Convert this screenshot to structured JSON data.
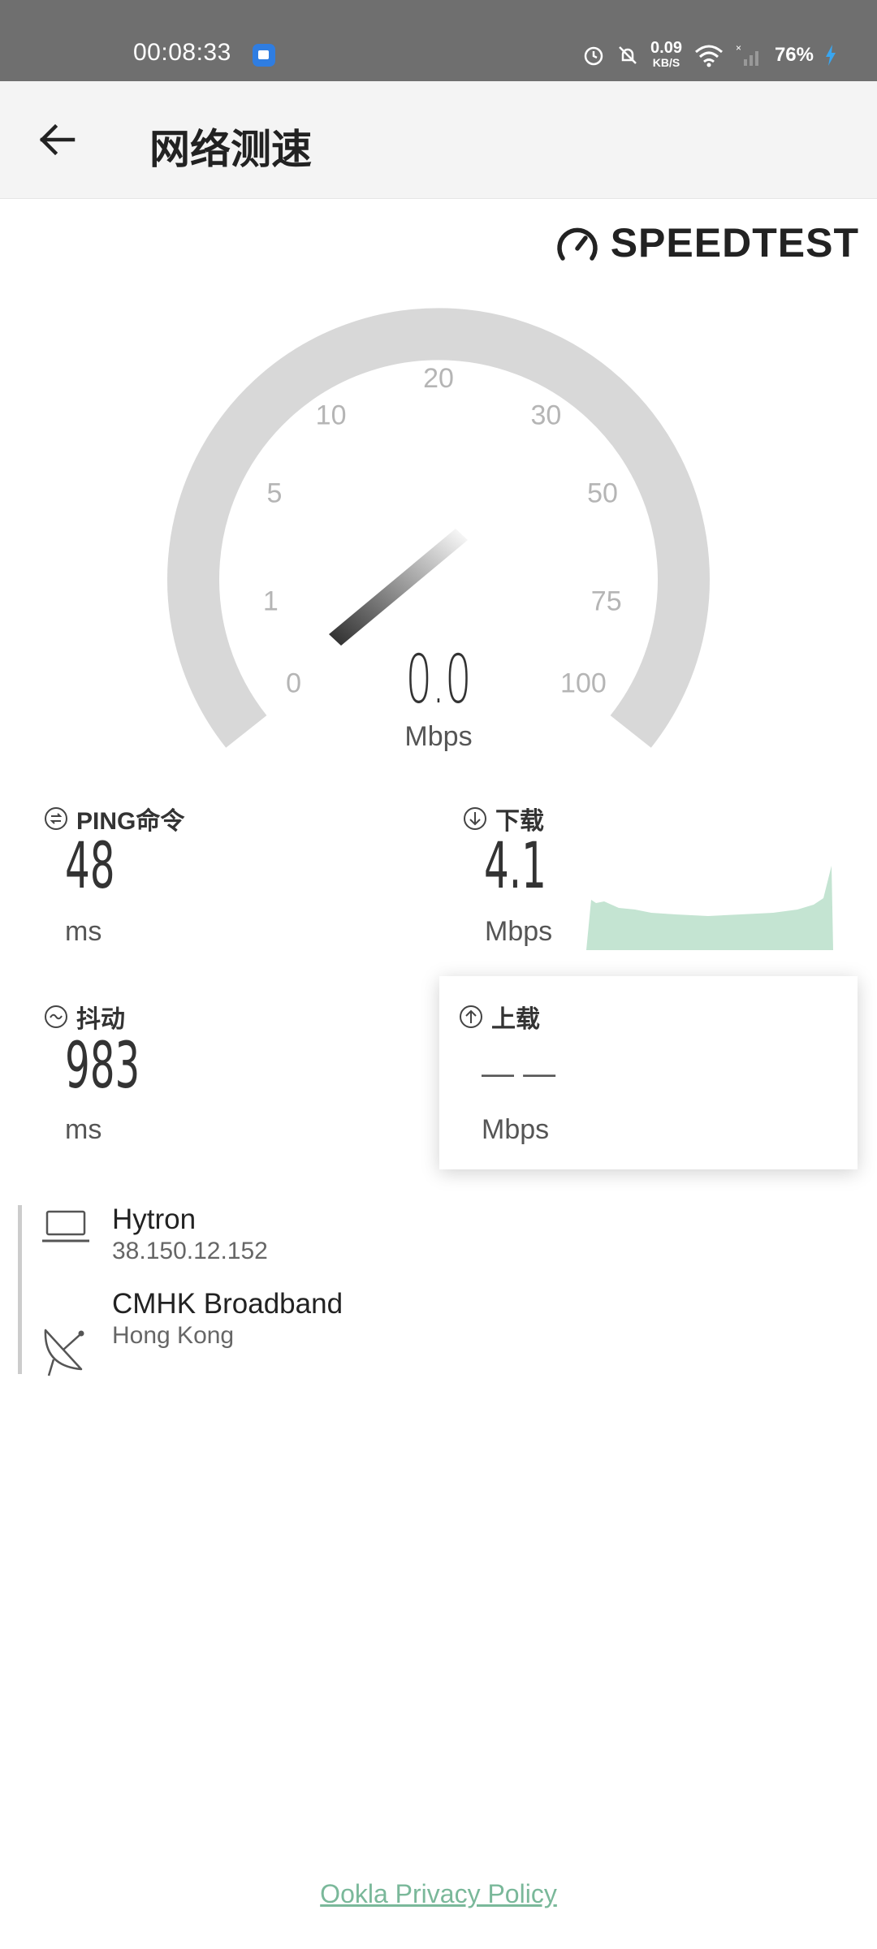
{
  "status_bar": {
    "time": "00:08:33",
    "speed_value": "0.09",
    "speed_unit": "KB/S",
    "battery": "76%",
    "icons": [
      "alarm-icon",
      "mute-icon",
      "wifi-icon",
      "no-signal-icon",
      "charging-icon"
    ]
  },
  "app_bar": {
    "title": "网络测速"
  },
  "brand": {
    "logo_text": "SPEEDTEST"
  },
  "gauge": {
    "tick_labels": [
      "0",
      "1",
      "5",
      "10",
      "20",
      "30",
      "50",
      "75",
      "100"
    ],
    "current_speed": "0.0",
    "unit": "Mbps"
  },
  "metrics": {
    "ping": {
      "label": "PING命令",
      "value": "48",
      "unit": "ms"
    },
    "download": {
      "label": "下载",
      "value": "4.1",
      "unit": "Mbps"
    },
    "jitter": {
      "label": "抖动",
      "value": "983",
      "unit": "ms"
    },
    "upload": {
      "label": "上载",
      "value": "— —",
      "unit": "Mbps"
    }
  },
  "servers": {
    "client": {
      "name": "Hytron",
      "ip": "38.150.12.152"
    },
    "host": {
      "name": "CMHK Broadband",
      "location": "Hong Kong"
    }
  },
  "footer": {
    "privacy_link": "Ookla Privacy Policy"
  },
  "colors": {
    "accent_green": "#7ab89a",
    "gauge_gray": "#d8d8d8",
    "status_bar": "#6f6f6f"
  }
}
